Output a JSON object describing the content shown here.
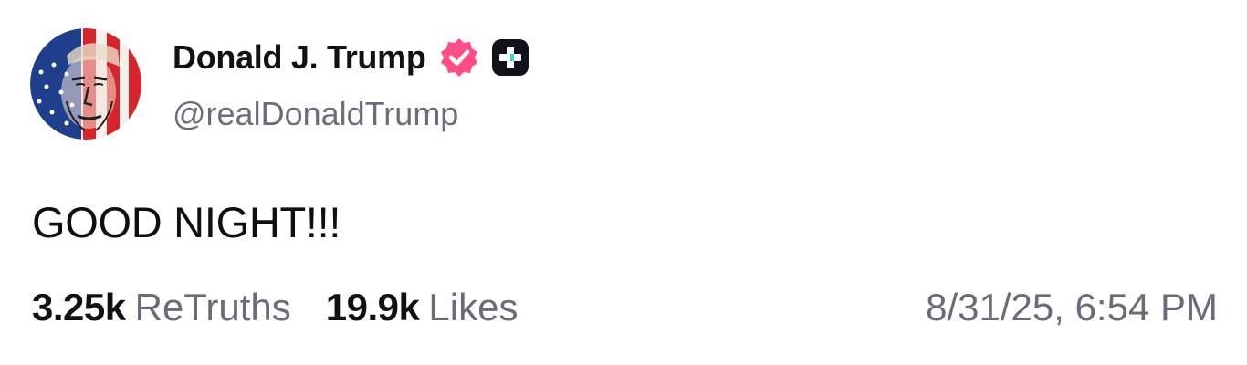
{
  "post": {
    "author": {
      "display_name": "Donald J. Trump",
      "handle": "@realDonaldTrump",
      "avatar_icon": "flag-portrait-avatar",
      "verified_icon": "verified-badge-icon",
      "plus_icon": "truth-plus-icon"
    },
    "text": "GOOD NIGHT!!!",
    "stats": {
      "retruths_count": "3.25k",
      "retruths_label": "ReTruths",
      "likes_count": "19.9k",
      "likes_label": "Likes"
    },
    "timestamp": "8/31/25, 6:54 PM"
  },
  "colors": {
    "background": "#ffffff",
    "name": "#111216",
    "secondary_text": "#686c78",
    "verified_badge": "#ff4d85",
    "plus_badge": "#12131a",
    "plus_accent": "#41d8c6"
  }
}
